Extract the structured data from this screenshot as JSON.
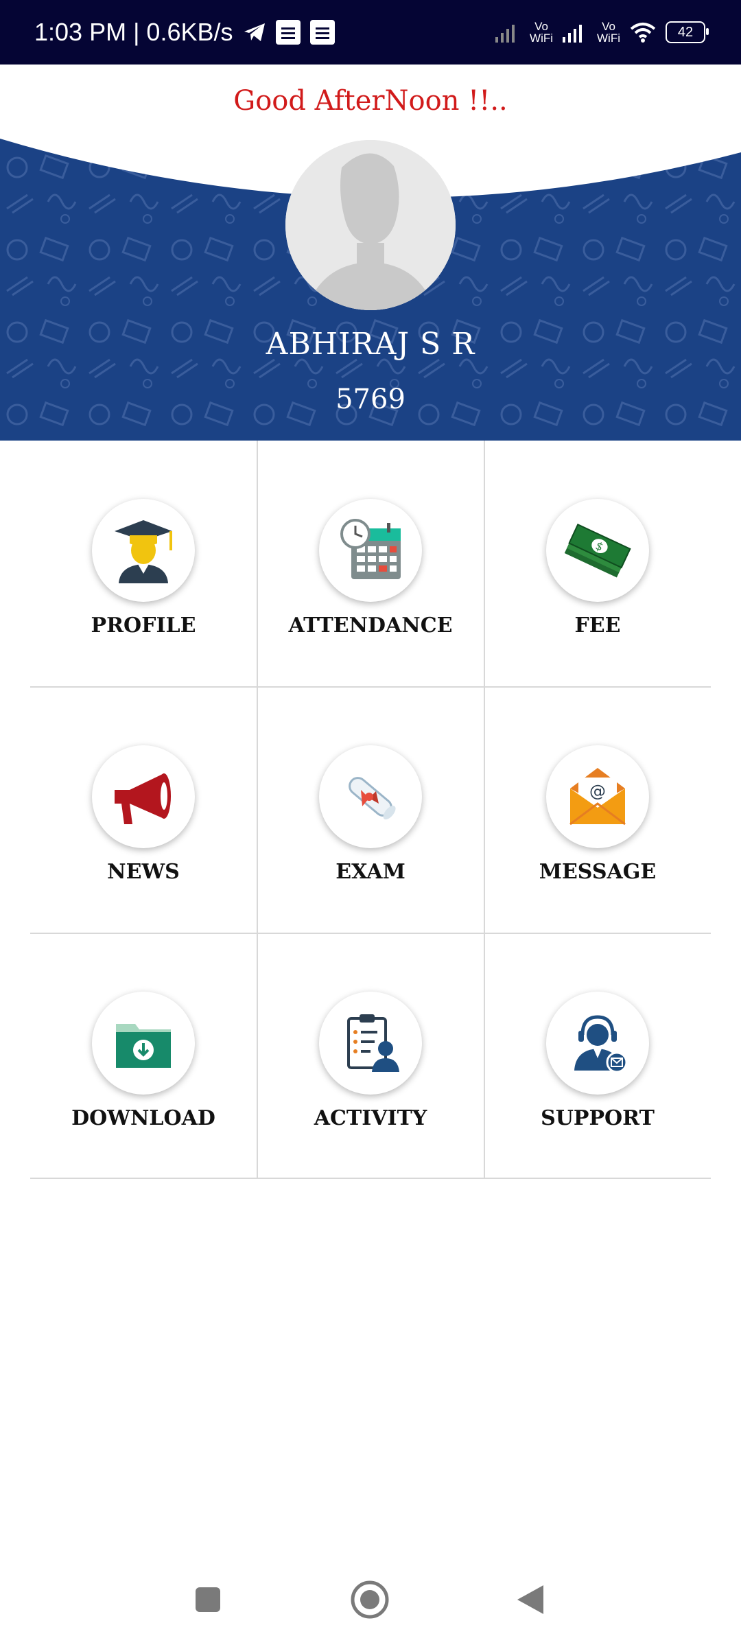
{
  "status_bar": {
    "time_speed": "1:03 PM | 0.6KB/s",
    "vowifi_1": "Vo\nWiFi",
    "vowifi_2": "Vo\nWiFi",
    "battery": "42"
  },
  "header": {
    "greeting": "Good AfterNoon !!..",
    "name": "ABHIRAJ S R",
    "id": "5769",
    "bg_color": "#1b4285"
  },
  "menu": {
    "profile": "PROFILE",
    "attendance": "ATTENDANCE",
    "fee": "FEE",
    "news": "NEWS",
    "exam": "EXAM",
    "message": "MESSAGE",
    "download": "DOWNLOAD",
    "activity": "ACTIVITY",
    "support": "SUPPORT"
  },
  "icons": [
    "graduate-icon",
    "calendar-clock-icon",
    "money-stack-icon",
    "megaphone-icon",
    "diploma-icon",
    "mail-envelope-icon",
    "download-folder-icon",
    "clipboard-person-icon",
    "support-agent-icon"
  ],
  "colors": {
    "greeting": "#d11a1a",
    "status_bar": "#050534"
  }
}
